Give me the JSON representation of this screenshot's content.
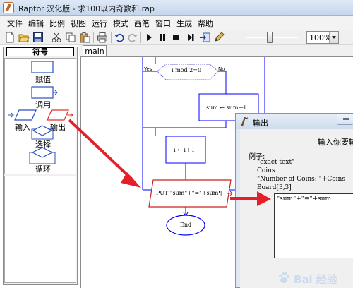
{
  "window": {
    "title": "Raptor 汉化版 - 求100以内奇数和.rap"
  },
  "menu": {
    "items": [
      "文件",
      "编辑",
      "比例",
      "视图",
      "运行",
      "模式",
      "画笔",
      "窗口",
      "生成",
      "帮助"
    ]
  },
  "toolbar": {
    "zoom_value": "100%"
  },
  "symbols": {
    "header": "符号",
    "assign": "赋值",
    "call": "调用",
    "input": "输入",
    "output": "输出",
    "selection": "选择",
    "loop": "循环"
  },
  "tabs": {
    "main": "main"
  },
  "flowchart": {
    "condition": "i mod 2=0",
    "yes": "Yes",
    "no": "No",
    "sum_assign": "sum ← sum＋i",
    "i_assign": "i ← i＋1",
    "put": "PUT \"sum\"+\"=\"+sum¶",
    "end": "End"
  },
  "output_dialog": {
    "title": "输出",
    "prompt": "输入你要输出",
    "example_label": "例子:",
    "examples": [
      "\"exact text\"",
      "Coins",
      "\"Number of Coins: \"+Coins",
      "Board[3,3]"
    ],
    "input_value": "\"sum\"+\"=\"+sum"
  },
  "watermark": {
    "text": "Bai 经验"
  },
  "colors": {
    "flow_line": "#0000ff",
    "flow_shape": "#6b6bd6",
    "annotation_red": "#e3202a",
    "put_box": "#cc2222"
  }
}
